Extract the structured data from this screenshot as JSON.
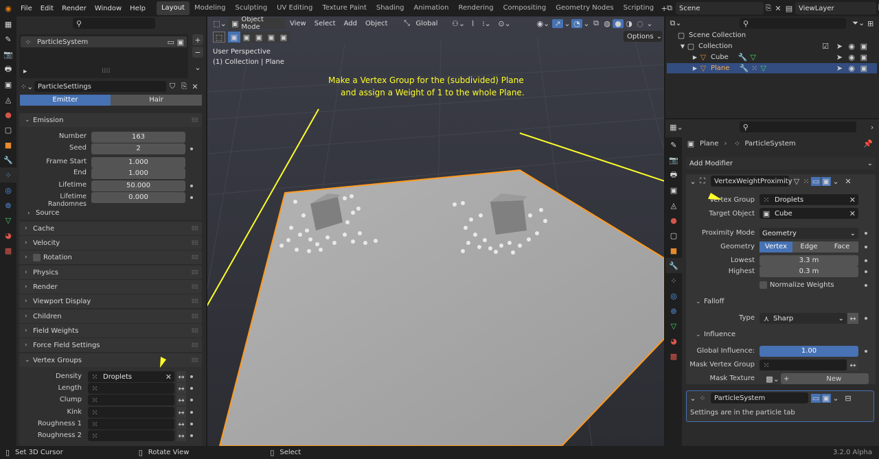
{
  "menu": [
    "File",
    "Edit",
    "Render",
    "Window",
    "Help"
  ],
  "workspaces": [
    "Layout",
    "Modeling",
    "Sculpting",
    "UV Editing",
    "Texture Paint",
    "Shading",
    "Animation",
    "Rendering",
    "Compositing",
    "Geometry Nodes",
    "Scripting"
  ],
  "active_workspace": "Layout",
  "scene": "Scene",
  "view_layer": "ViewLayer",
  "left": {
    "particle_system": "ParticleSystem",
    "particle_settings": "ParticleSettings",
    "tab_emitter": "Emitter",
    "tab_hair": "Hair",
    "emission": "Emission",
    "props": [
      {
        "label": "Number",
        "value": "163"
      },
      {
        "label": "Seed",
        "value": "2"
      },
      {
        "label": "Frame Start",
        "value": "1.000"
      },
      {
        "label": "End",
        "value": "1.000"
      },
      {
        "label": "Lifetime",
        "value": "50.000"
      },
      {
        "label": "Lifetime Randomnes",
        "value": "0.000"
      }
    ],
    "source": "Source",
    "sections": [
      "Cache",
      "Velocity",
      "Rotation",
      "Physics",
      "Render",
      "Viewport Display",
      "Children",
      "Field Weights",
      "Force Field Settings"
    ],
    "vertex_groups": "Vertex Groups",
    "vg_rows": [
      {
        "label": "Density",
        "value": "Droplets"
      },
      {
        "label": "Length",
        "value": ""
      },
      {
        "label": "Clump",
        "value": ""
      },
      {
        "label": "Kink",
        "value": ""
      },
      {
        "label": "Roughness 1",
        "value": ""
      },
      {
        "label": "Roughness 2",
        "value": ""
      }
    ]
  },
  "viewport": {
    "mode": "Object Mode",
    "menus": [
      "View",
      "Select",
      "Add",
      "Object"
    ],
    "orientation": "Global",
    "options": "Options",
    "perspective": "User Perspective",
    "collection": "(1) Collection | Plane",
    "annotation_line1": "Make a Vertex Group for the (subdivided) Plane",
    "annotation_line2": "and assign a Weight of 1 to the whole Plane."
  },
  "outliner": {
    "root": "Scene Collection",
    "collection": "Collection",
    "items": [
      "Cube",
      "Plane"
    ]
  },
  "props": {
    "object": "Plane",
    "particle": "ParticleSystem",
    "add_modifier": "Add Modifier",
    "modifier": "VertexWeightProximity",
    "vertex_group_label": "Vertex Group",
    "vertex_group": "Droplets",
    "target_label": "Target Object",
    "target": "Cube",
    "prox_label": "Proximity Mode",
    "prox": "Geometry",
    "geom_label": "Geometry",
    "geom": [
      "Vertex",
      "Edge",
      "Face"
    ],
    "lowest_label": "Lowest",
    "lowest": "3.3 m",
    "highest_label": "Highest",
    "highest": "0.3 m",
    "normalize": "Normalize Weights",
    "falloff": "Falloff",
    "type_label": "Type",
    "type": "Sharp",
    "influence": "Influence",
    "gi_label": "Global Influence:",
    "gi": "1.00",
    "mask_vg": "Mask Vertex Group",
    "mask_tex": "Mask Texture",
    "new": "New",
    "ps_modifier": "ParticleSystem",
    "ps_note": "Settings are in the particle tab"
  },
  "status": {
    "left": "Set 3D Cursor",
    "mid": "Rotate View",
    "select": "Select",
    "version": "3.2.0 Alpha"
  },
  "colors": {
    "accent": "#4772b3",
    "selection": "#ff9a1f",
    "annotation": "#ffff2a"
  }
}
